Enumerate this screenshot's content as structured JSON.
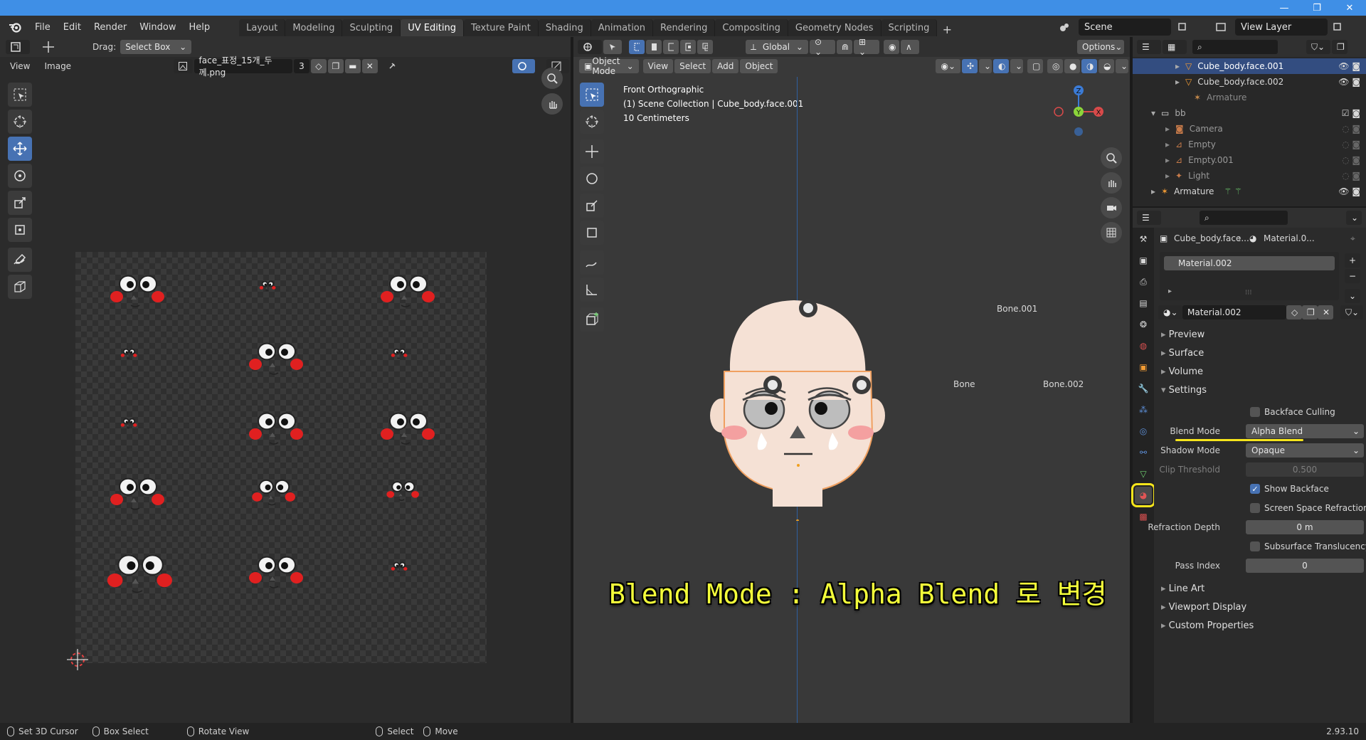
{
  "window": {
    "minimize": "—",
    "maximize": "❐",
    "close": "✕"
  },
  "menu": [
    "File",
    "Edit",
    "Render",
    "Window",
    "Help"
  ],
  "workspaces": [
    {
      "label": "Layout",
      "active": false
    },
    {
      "label": "Modeling",
      "active": false
    },
    {
      "label": "Sculpting",
      "active": false
    },
    {
      "label": "UV Editing",
      "active": true
    },
    {
      "label": "Texture Paint",
      "active": false
    },
    {
      "label": "Shading",
      "active": false
    },
    {
      "label": "Animation",
      "active": false
    },
    {
      "label": "Rendering",
      "active": false
    },
    {
      "label": "Compositing",
      "active": false
    },
    {
      "label": "Geometry Nodes",
      "active": false
    },
    {
      "label": "Scripting",
      "active": false
    }
  ],
  "ws_plus": "+",
  "scene": {
    "name": "Scene",
    "view_layer": "View Layer"
  },
  "uv_editor": {
    "drag_label": "Drag:",
    "drag_mode": "Select Box",
    "view": "View",
    "image": "Image",
    "image_name": "face_표정_15개_두께.png",
    "user_count": "3"
  },
  "viewport": {
    "mode": "Object Mode",
    "menus": [
      "View",
      "Select",
      "Add",
      "Object"
    ],
    "orientation": "Global",
    "options": "Options",
    "info": [
      "Front Orthographic",
      "(1) Scene Collection | Cube_body.face.001",
      "10 Centimeters"
    ],
    "bones": [
      "Bone.001",
      "Bone",
      "Bone.002"
    ],
    "gizmo": {
      "z": "Z",
      "y": "Y",
      "x": "X"
    },
    "caption": "Blend Mode : Alpha Blend 로 변경"
  },
  "outliner": {
    "rows": [
      {
        "label": "Cube_body.face.001",
        "selected": true
      },
      {
        "label": "Cube_body.face.002",
        "selected": false
      },
      {
        "label": "Armature",
        "selected": false
      },
      {
        "label": "bb",
        "selected": false
      },
      {
        "label": "Camera",
        "selected": false
      },
      {
        "label": "Empty",
        "selected": false
      },
      {
        "label": "Empty.001",
        "selected": false
      },
      {
        "label": "Light",
        "selected": false
      },
      {
        "label": "Armature",
        "selected": false
      }
    ]
  },
  "properties": {
    "breadcrumb_object": "Cube_body.face...",
    "breadcrumb_material": "Material.0...",
    "slot": "Material.002",
    "material_name": "Material.002",
    "sections": [
      "Preview",
      "Surface",
      "Volume",
      "Settings"
    ],
    "settings": {
      "backface_culling": "Backface Culling",
      "blend_mode_label": "Blend Mode",
      "blend_mode": "Alpha Blend",
      "shadow_mode_label": "Shadow Mode",
      "shadow_mode": "Opaque",
      "clip_threshold_label": "Clip Threshold",
      "clip_threshold": "0.500",
      "show_backface": "Show Backface",
      "ssr": "Screen Space Refraction",
      "refraction_depth_label": "Refraction Depth",
      "refraction_depth": "0 m",
      "sss": "Subsurface Translucency",
      "pass_index_label": "Pass Index",
      "pass_index": "0"
    },
    "more_sections": [
      "Line Art",
      "Viewport Display",
      "Custom Properties"
    ]
  },
  "status": {
    "items": [
      "Set 3D Cursor",
      "Box Select",
      "Rotate View",
      "Select",
      "Move"
    ],
    "version": "2.93.10"
  },
  "colors": {
    "accent": "#4772b3",
    "highlight": "#f6e51b",
    "titlebar": "#3f8fe6"
  }
}
